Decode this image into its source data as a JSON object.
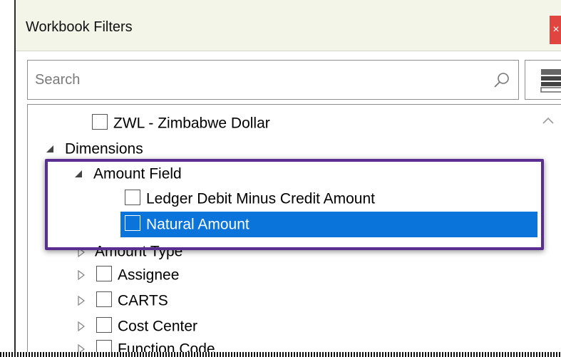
{
  "dialog": {
    "title": "Workbook Filters",
    "close_label": "×"
  },
  "search": {
    "placeholder": "Search"
  },
  "tree": {
    "top_item": "ZWL - Zimbabwe Dollar",
    "dimensions_label": "Dimensions",
    "amount_field": {
      "label": "Amount Field",
      "children": [
        "Ledger Debit Minus Credit Amount",
        "Natural Amount"
      ]
    },
    "items": [
      "Amount Type",
      "Assignee",
      "CARTS",
      "Cost Center",
      "Function Code"
    ]
  },
  "colors": {
    "selection": "#0a74da",
    "highlight_border": "#5a2d91",
    "close_button": "#e0463f"
  }
}
